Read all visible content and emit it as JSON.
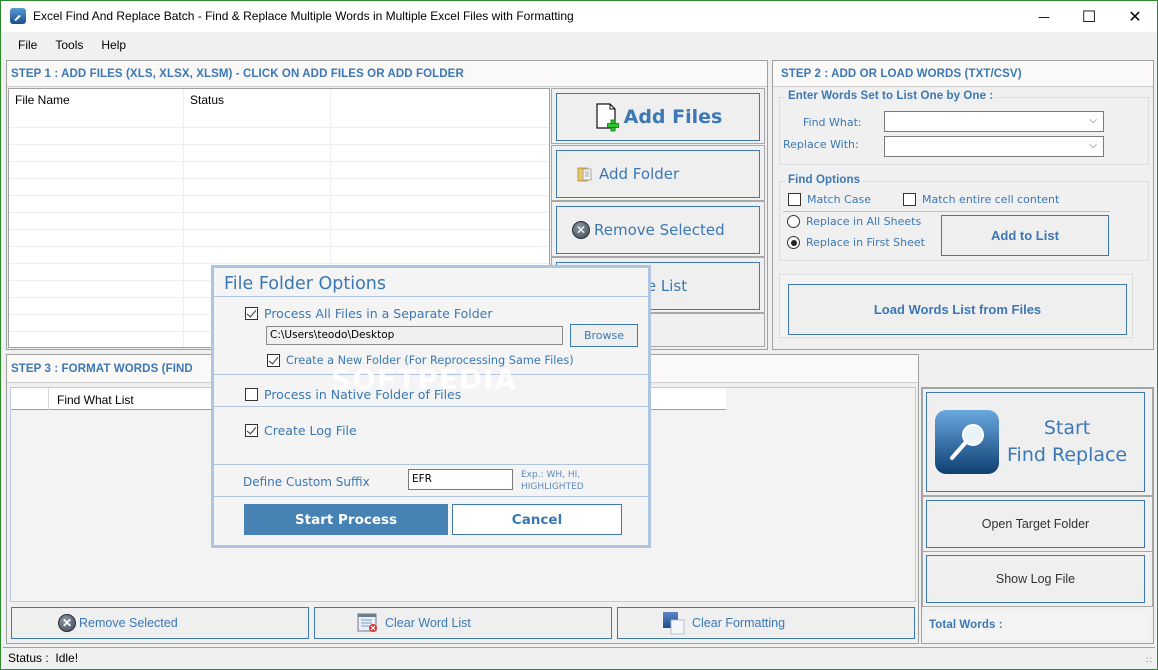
{
  "window": {
    "title": "Excel Find And Replace Batch - Find & Replace Multiple Words in Multiple Excel Files with Formatting",
    "controls": {
      "minimize": "—",
      "maximize": "☐",
      "close": "✕"
    }
  },
  "menu": {
    "items": [
      "File",
      "Tools",
      "Help"
    ]
  },
  "step1": {
    "header": "STEP 1 : ADD FILES (XLS, XLSX, XLSM) - CLICK ON ADD FILES OR ADD FOLDER",
    "columns": [
      "File Name",
      "Status",
      ""
    ],
    "rows": [],
    "buttons": {
      "add_files": "Add Files",
      "add_folder": "Add Folder",
      "remove_selected": "Remove Selected",
      "clear_file_list": "Clear File List"
    }
  },
  "step2": {
    "header": "STEP 2 : ADD OR LOAD WORDS (TXT/CSV)",
    "enter_words_legend": "Enter Words Set to List One by One :",
    "find_what_label": "Find What:",
    "find_what_value": "",
    "replace_with_label": "Replace With:",
    "replace_with_value": "",
    "find_options_legend": "Find Options",
    "match_case": {
      "label": "Match Case",
      "checked": false
    },
    "match_entire": {
      "label": "Match entire cell content",
      "checked": false
    },
    "replace_all_sheets": {
      "label": "Replace in All Sheets",
      "selected": false
    },
    "replace_first_sheet": {
      "label": "Replace in First Sheet",
      "selected": true
    },
    "add_to_list": "Add to List",
    "load_words": "Load Words List from Files"
  },
  "step3": {
    "header": "STEP 3 : FORMAT WORDS (FIND",
    "columns": [
      "",
      "Find What List"
    ],
    "buttons": {
      "remove_selected": "Remove Selected",
      "clear_word_list": "Clear Word List",
      "clear_formatting": "Clear Formatting"
    }
  },
  "actions": {
    "start_line1": "Start",
    "start_line2": "Find Replace",
    "open_target_folder": "Open Target Folder",
    "show_log_file": "Show Log File",
    "total_words_label": "Total Words :"
  },
  "status": {
    "text": "Status :  Idle!"
  },
  "dialog": {
    "title": "File Folder Options",
    "process_separate": {
      "label": "Process All Files in a Separate Folder",
      "checked": true
    },
    "folder_path": "C:\\Users\\teodo\\Desktop",
    "browse": "Browse",
    "create_new_folder": {
      "label": "Create a New Folder (For Reprocessing Same Files)",
      "checked": true
    },
    "process_native": {
      "label": "Process in Native Folder of Files",
      "checked": false
    },
    "create_log": {
      "label": "Create Log File",
      "checked": true
    },
    "suffix_label": "Define Custom Suffix",
    "suffix_value": "EFR",
    "suffix_hint_line1": "Exp.: WH, HI,",
    "suffix_hint_line2": "HIGHLIGHTED",
    "start_process": "Start Process",
    "cancel": "Cancel"
  },
  "watermark": "SOFTPEDIA",
  "colors": {
    "accent": "#3b78b4",
    "primary_button": "#4682b4",
    "dialog_border": "#aec5e0"
  }
}
